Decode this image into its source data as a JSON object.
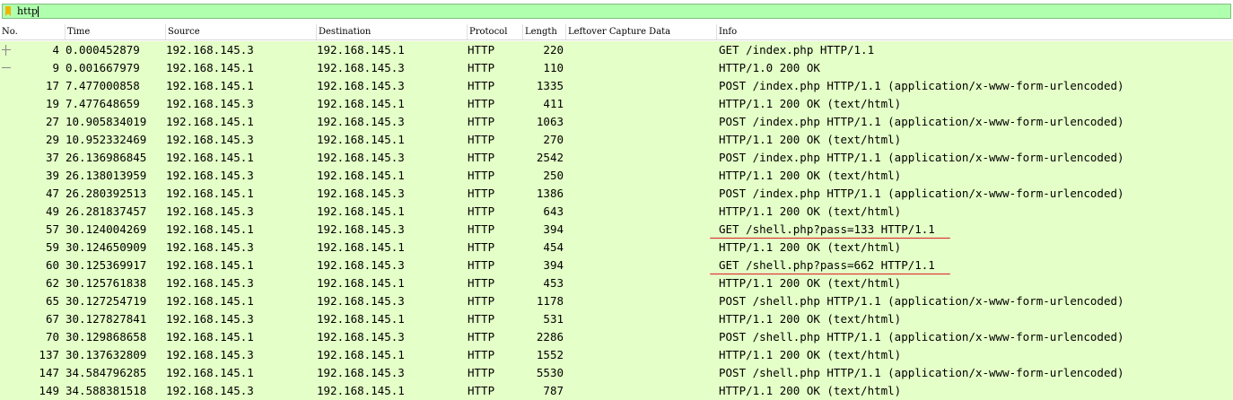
{
  "filter": {
    "text": "http"
  },
  "columns": {
    "no": "No.",
    "time": "Time",
    "source": "Source",
    "destination": "Destination",
    "protocol": "Protocol",
    "length": "Length",
    "leftover": "Leftover Capture Data",
    "info": "Info"
  },
  "colors": {
    "row_bg": "#e4ffc7",
    "filter_bg": "#afffaf",
    "annotation": "#e02020"
  },
  "packets": [
    {
      "no": "4",
      "time": "0.000452879",
      "src": "192.168.145.3",
      "dst": "192.168.145.1",
      "proto": "HTTP",
      "len": "220",
      "info": "GET /index.php HTTP/1.1"
    },
    {
      "no": "9",
      "time": "0.001667979",
      "src": "192.168.145.1",
      "dst": "192.168.145.3",
      "proto": "HTTP",
      "len": "110",
      "info": "HTTP/1.0 200 OK"
    },
    {
      "no": "17",
      "time": "7.477000858",
      "src": "192.168.145.1",
      "dst": "192.168.145.3",
      "proto": "HTTP",
      "len": "1335",
      "info": "POST /index.php HTTP/1.1  (application/x-www-form-urlencoded)"
    },
    {
      "no": "19",
      "time": "7.477648659",
      "src": "192.168.145.3",
      "dst": "192.168.145.1",
      "proto": "HTTP",
      "len": "411",
      "info": "HTTP/1.1 200 OK  (text/html)"
    },
    {
      "no": "27",
      "time": "10.905834019",
      "src": "192.168.145.1",
      "dst": "192.168.145.3",
      "proto": "HTTP",
      "len": "1063",
      "info": "POST /index.php HTTP/1.1  (application/x-www-form-urlencoded)"
    },
    {
      "no": "29",
      "time": "10.952332469",
      "src": "192.168.145.3",
      "dst": "192.168.145.1",
      "proto": "HTTP",
      "len": "270",
      "info": "HTTP/1.1 200 OK  (text/html)"
    },
    {
      "no": "37",
      "time": "26.136986845",
      "src": "192.168.145.1",
      "dst": "192.168.145.3",
      "proto": "HTTP",
      "len": "2542",
      "info": "POST /index.php HTTP/1.1  (application/x-www-form-urlencoded)"
    },
    {
      "no": "39",
      "time": "26.138013959",
      "src": "192.168.145.3",
      "dst": "192.168.145.1",
      "proto": "HTTP",
      "len": "250",
      "info": "HTTP/1.1 200 OK  (text/html)"
    },
    {
      "no": "47",
      "time": "26.280392513",
      "src": "192.168.145.1",
      "dst": "192.168.145.3",
      "proto": "HTTP",
      "len": "1386",
      "info": "POST /index.php HTTP/1.1  (application/x-www-form-urlencoded)"
    },
    {
      "no": "49",
      "time": "26.281837457",
      "src": "192.168.145.3",
      "dst": "192.168.145.1",
      "proto": "HTTP",
      "len": "643",
      "info": "HTTP/1.1 200 OK  (text/html)"
    },
    {
      "no": "57",
      "time": "30.124004269",
      "src": "192.168.145.1",
      "dst": "192.168.145.3",
      "proto": "HTTP",
      "len": "394",
      "info": "GET /shell.php?pass=133 HTTP/1.1",
      "marked": true
    },
    {
      "no": "59",
      "time": "30.124650909",
      "src": "192.168.145.3",
      "dst": "192.168.145.1",
      "proto": "HTTP",
      "len": "454",
      "info": "HTTP/1.1 200 OK  (text/html)"
    },
    {
      "no": "60",
      "time": "30.125369917",
      "src": "192.168.145.1",
      "dst": "192.168.145.3",
      "proto": "HTTP",
      "len": "394",
      "info": "GET /shell.php?pass=662 HTTP/1.1",
      "marked": true
    },
    {
      "no": "62",
      "time": "30.125761838",
      "src": "192.168.145.3",
      "dst": "192.168.145.1",
      "proto": "HTTP",
      "len": "453",
      "info": "HTTP/1.1 200 OK  (text/html)"
    },
    {
      "no": "65",
      "time": "30.127254719",
      "src": "192.168.145.1",
      "dst": "192.168.145.3",
      "proto": "HTTP",
      "len": "1178",
      "info": "POST /shell.php HTTP/1.1  (application/x-www-form-urlencoded)"
    },
    {
      "no": "67",
      "time": "30.127827841",
      "src": "192.168.145.3",
      "dst": "192.168.145.1",
      "proto": "HTTP",
      "len": "531",
      "info": "HTTP/1.1 200 OK  (text/html)"
    },
    {
      "no": "70",
      "time": "30.129868658",
      "src": "192.168.145.1",
      "dst": "192.168.145.3",
      "proto": "HTTP",
      "len": "2286",
      "info": "POST /shell.php HTTP/1.1  (application/x-www-form-urlencoded)"
    },
    {
      "no": "137",
      "time": "30.137632809",
      "src": "192.168.145.3",
      "dst": "192.168.145.1",
      "proto": "HTTP",
      "len": "1552",
      "info": "HTTP/1.1 200 OK  (text/html)"
    },
    {
      "no": "147",
      "time": "34.584796285",
      "src": "192.168.145.1",
      "dst": "192.168.145.3",
      "proto": "HTTP",
      "len": "5530",
      "info": "POST /shell.php HTTP/1.1  (application/x-www-form-urlencoded)"
    },
    {
      "no": "149",
      "time": "34.588381518",
      "src": "192.168.145.3",
      "dst": "192.168.145.1",
      "proto": "HTTP",
      "len": "787",
      "info": "HTTP/1.1 200 OK  (text/html)"
    }
  ]
}
